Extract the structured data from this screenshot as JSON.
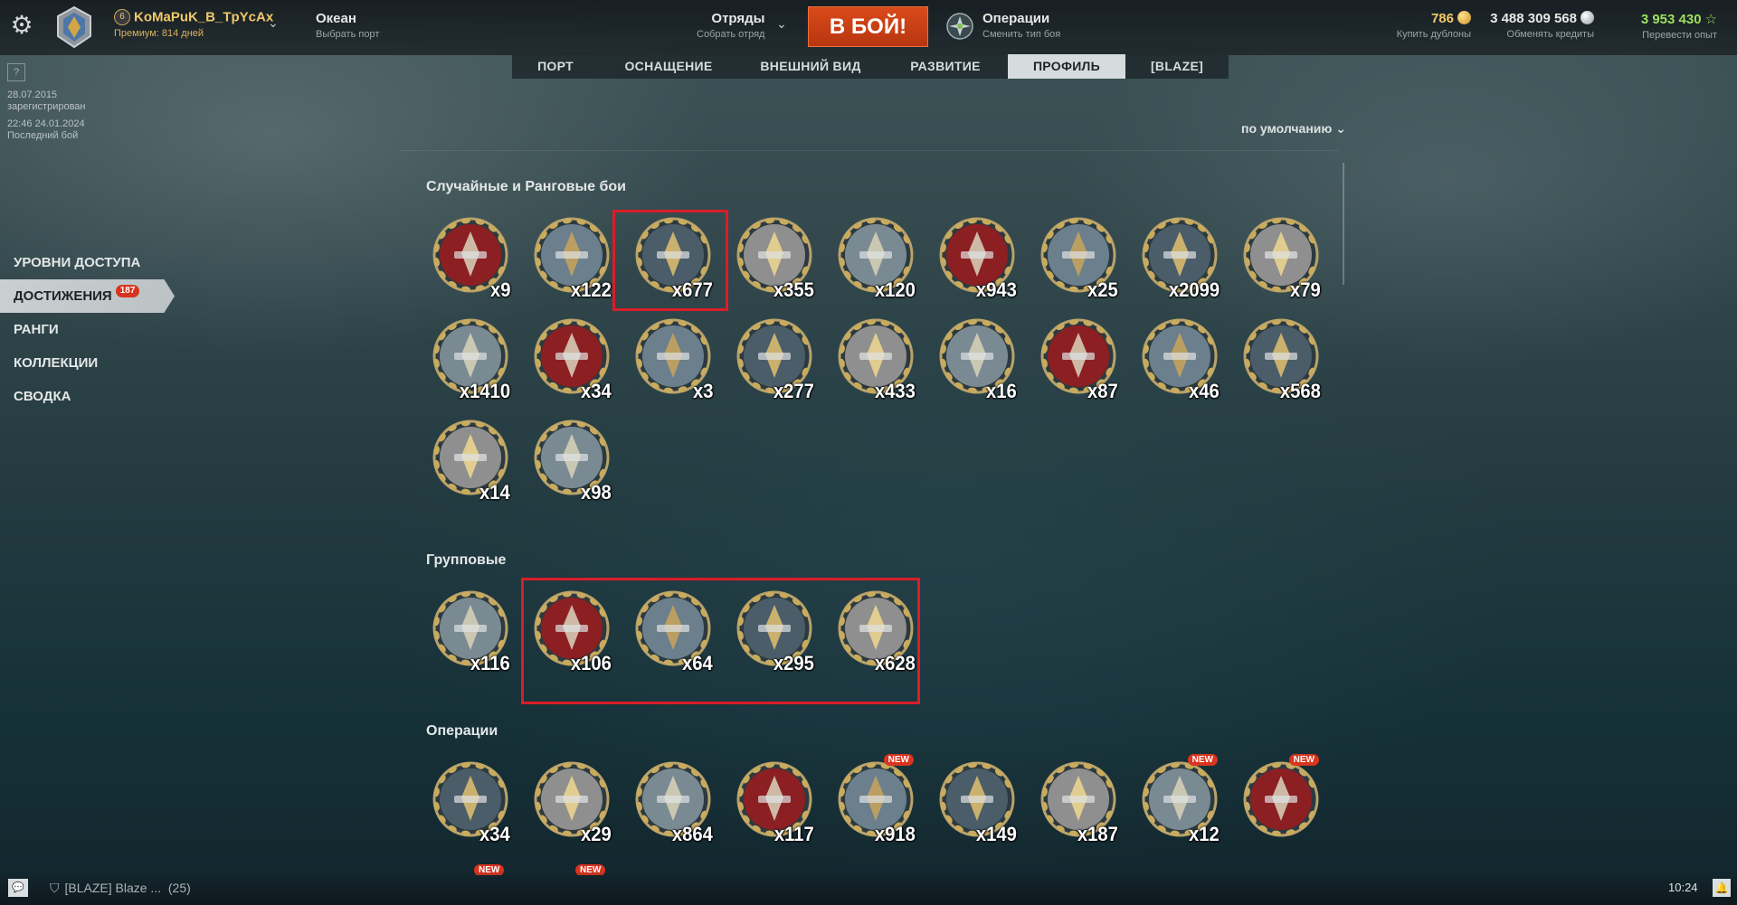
{
  "header": {
    "settings_icon": "gear-icon",
    "player_level": "6",
    "player_name": "KoMaPuK_B_TpYcAx",
    "premium": "Премиум: 814 дней",
    "port_name": "Океан",
    "port_sub": "Выбрать порт",
    "squad_label": "Отряды",
    "squad_sub": "Собрать отряд",
    "battle_button": "В БОЙ!",
    "mode_label": "Операции",
    "mode_sub": "Сменить тип боя",
    "doubloons": "786",
    "doubloons_sub": "Купить дублоны",
    "credits": "3 488 309 568",
    "credits_sub": "Обменять кредиты",
    "xp": "3 953 430",
    "xp_sub": "Перевести опыт",
    "colors": {
      "gold": "#f0c86a",
      "battle": "#c8401a",
      "xp": "#9ee05e"
    }
  },
  "tabs": [
    {
      "label": "ПОРТ",
      "active": false
    },
    {
      "label": "ОСНАЩЕНИЕ",
      "active": false
    },
    {
      "label": "ВНЕШНИЙ ВИД",
      "active": false
    },
    {
      "label": "РАЗВИТИЕ",
      "active": false
    },
    {
      "label": "ПРОФИЛЬ",
      "active": true
    },
    {
      "label": "[BLAZE]",
      "active": false
    }
  ],
  "profile": {
    "help": "?",
    "registered_date": "28.07.2015",
    "registered_label": "зарегистрирован",
    "last_battle_date": "22:46  24.01.2024",
    "last_battle_label": "Последний бой"
  },
  "sidebar": [
    {
      "label": "УРОВНИ ДОСТУПА",
      "active": false,
      "badge": ""
    },
    {
      "label": "ДОСТИЖЕНИЯ",
      "active": true,
      "badge": "187"
    },
    {
      "label": "РАНГИ",
      "active": false,
      "badge": ""
    },
    {
      "label": "КОЛЛЕКЦИИ",
      "active": false,
      "badge": ""
    },
    {
      "label": "СВОДКА",
      "active": false,
      "badge": ""
    }
  ],
  "sort_label": "по умолчанию",
  "sections": {
    "random": {
      "title": "Случайные и Ранговые бои",
      "medals": [
        {
          "icon": "ship-ribbon-medal-icon",
          "count": "x9"
        },
        {
          "icon": "kraken-medal-icon",
          "count": "x122"
        },
        {
          "icon": "torpedo-medal-icon",
          "count": "x677"
        },
        {
          "icon": "aircraft-carrier-medal-icon",
          "count": "x355"
        },
        {
          "icon": "wave-ship-medal-icon",
          "count": "x120"
        },
        {
          "icon": "battleship-medal-icon",
          "count": "x943"
        },
        {
          "icon": "binoculars-medal-icon",
          "count": "x25"
        },
        {
          "icon": "explosion-medal-icon",
          "count": "x2099"
        },
        {
          "icon": "double-strike-medal-icon",
          "count": "x79"
        },
        {
          "icon": "hourglass-medal-icon",
          "count": "x1410"
        },
        {
          "icon": "anti-air-medal-icon",
          "count": "x34"
        },
        {
          "icon": "crosshair-medal-icon",
          "count": "x3"
        },
        {
          "icon": "turret-fire-medal-icon",
          "count": "x277"
        },
        {
          "icon": "burning-ship-medal-icon",
          "count": "x433"
        },
        {
          "icon": "storm-medal-icon",
          "count": "x16"
        },
        {
          "icon": "fire-medal-icon",
          "count": "x87"
        },
        {
          "icon": "chain-anchor-medal-icon",
          "count": "x46"
        },
        {
          "icon": "winged-anchor-medal-icon",
          "count": "x568"
        },
        {
          "icon": "sailing-ship-medal-icon",
          "count": "x14"
        },
        {
          "icon": "detonation-medal-icon",
          "count": "x98"
        }
      ]
    },
    "group": {
      "title": "Групповые",
      "medals": [
        {
          "icon": "octopus-medal-icon",
          "count": "x116"
        },
        {
          "icon": "red-shield-medal-icon",
          "count": "x106"
        },
        {
          "icon": "sword-shield-medal-icon",
          "count": "x64"
        },
        {
          "icon": "fist-medal-icon",
          "count": "x295"
        },
        {
          "icon": "trident-medal-icon",
          "count": "x628"
        }
      ]
    },
    "operations": {
      "title": "Операции",
      "medals": [
        {
          "icon": "red-wings-medal-icon",
          "count": "x34",
          "new": ""
        },
        {
          "icon": "shell-cross-medal-icon",
          "count": "x29",
          "new": ""
        },
        {
          "icon": "sword-wreath-medal-icon",
          "count": "x864",
          "new": ""
        },
        {
          "icon": "shield-planes-medal-icon",
          "count": "x117",
          "new": ""
        },
        {
          "icon": "starfish-medal-icon",
          "count": "x918",
          "new": "NEW"
        },
        {
          "icon": "ring-medal-icon",
          "count": "x149",
          "new": ""
        },
        {
          "icon": "serpent-medal-icon",
          "count": "x187",
          "new": ""
        },
        {
          "icon": "fox-medal-icon",
          "count": "x12",
          "new": "NEW"
        },
        {
          "icon": "crown-rock-medal-icon",
          "count": "",
          "new": "NEW"
        }
      ],
      "partial_row_new": [
        "NEW",
        "NEW"
      ]
    }
  },
  "footer": {
    "clan_chat": "[BLAZE] Blaze ...",
    "clan_count": "(25)",
    "time": "10:24"
  }
}
